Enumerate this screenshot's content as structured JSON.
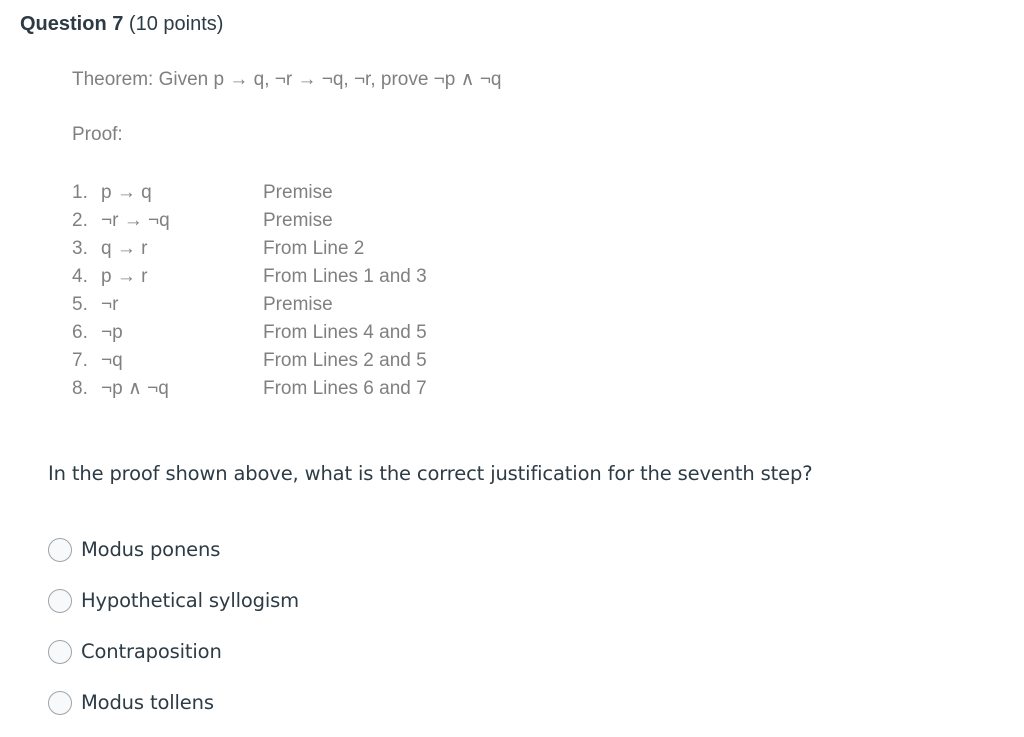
{
  "header": {
    "question_title": "Question 7",
    "points": "(10 points)"
  },
  "proof_block": {
    "theorem_line": "Theorem: Given p → q, ¬r → ¬q, ¬r, prove ¬p ∧ ¬q",
    "proof_label": "Proof:",
    "steps": [
      {
        "num": "1.",
        "statement": "p → q",
        "justification": "Premise"
      },
      {
        "num": "2.",
        "statement": "¬r → ¬q",
        "justification": "Premise"
      },
      {
        "num": "3.",
        "statement": "q → r",
        "justification": "From Line 2"
      },
      {
        "num": "4.",
        "statement": "p → r",
        "justification": "From Lines 1 and 3"
      },
      {
        "num": "5.",
        "statement": "¬r",
        "justification": "Premise"
      },
      {
        "num": "6.",
        "statement": "¬p",
        "justification": "From Lines 4 and 5"
      },
      {
        "num": "7.",
        "statement": "¬q",
        "justification": "From Lines 2 and 5"
      },
      {
        "num": "8.",
        "statement": "¬p ∧ ¬q",
        "justification": "From Lines 6 and 7"
      }
    ]
  },
  "prompt": "In the proof shown above, what is the correct justification for the seventh step?",
  "answers": {
    "selected": null,
    "options": [
      {
        "label": "Modus ponens"
      },
      {
        "label": "Hypothetical syllogism"
      },
      {
        "label": "Contraposition"
      },
      {
        "label": "Modus tollens"
      }
    ]
  },
  "colors": {
    "text_dark": "#2d3b45",
    "text_gray": "#808080",
    "radio_border": "#9ea4a8",
    "radio_fill": "#f8f9fb",
    "background": "#ffffff"
  }
}
